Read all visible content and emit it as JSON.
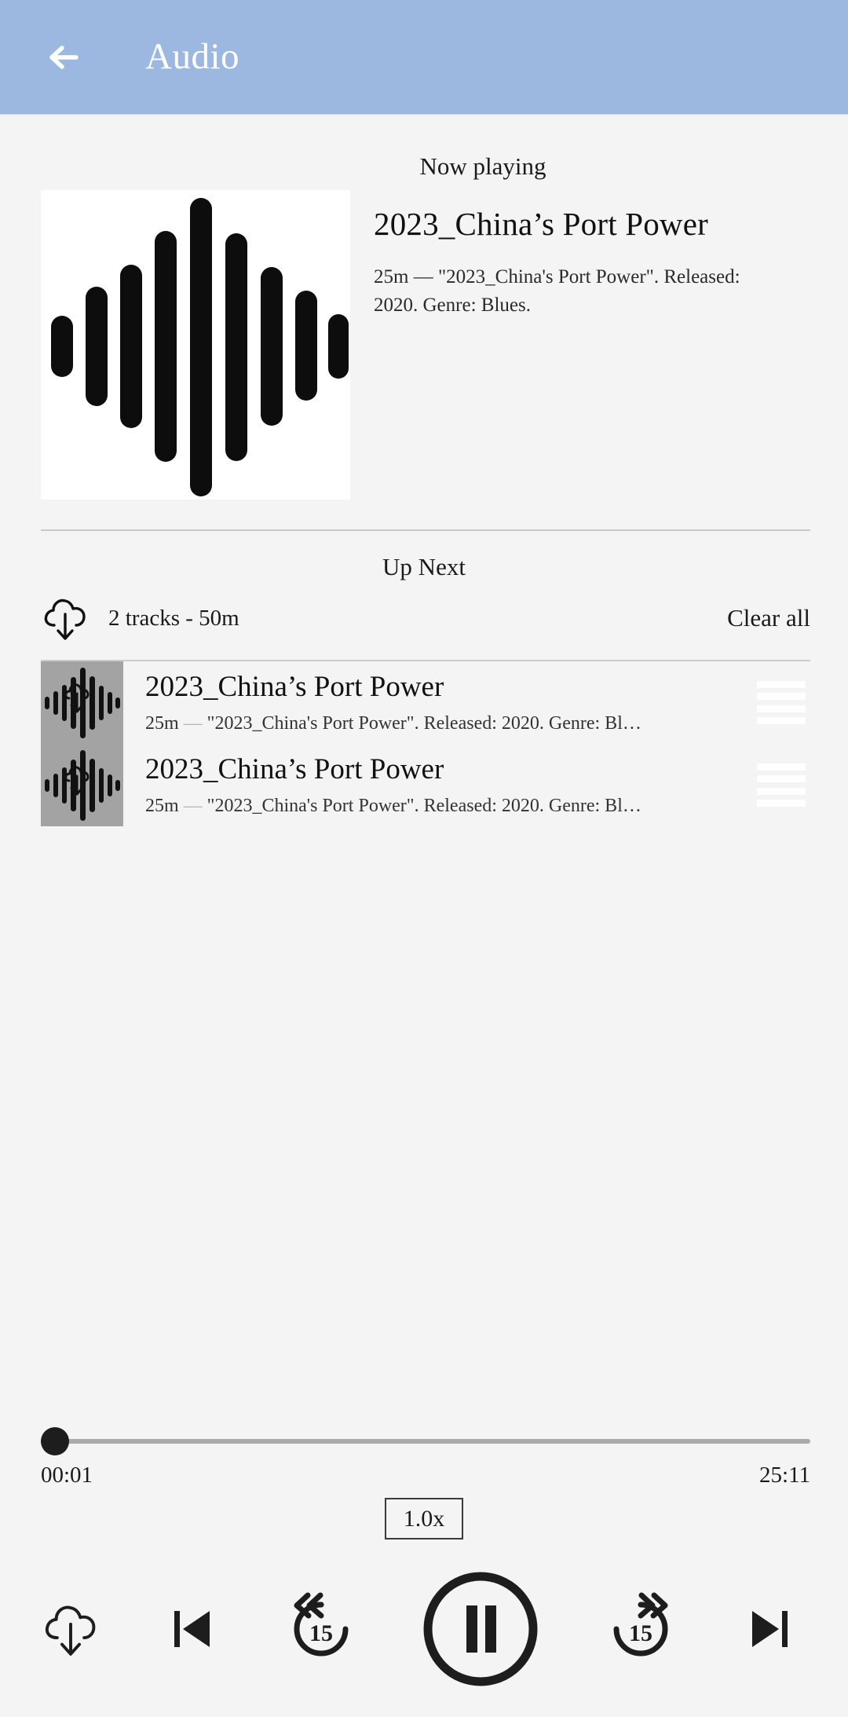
{
  "header": {
    "back_icon": "arrow-left-icon",
    "title": "Audio",
    "background_color": "#9cb8e0",
    "title_color": "#ffffff"
  },
  "now_playing": {
    "section_label": "Now playing",
    "album_art_icon": "audio-waveform-icon",
    "title": "2023_China’s Port Power",
    "description": "25m — \"2023_China's Port Power\". Released: 2020. Genre: Blues."
  },
  "up_next": {
    "section_label": "Up Next",
    "download_icon": "cloud-download-icon",
    "summary": "2 tracks - 50m",
    "clear_all_label": "Clear all",
    "tracks": [
      {
        "thumb_icon": "audio-waveform-download-icon",
        "title": "2023_China’s Port Power",
        "duration": "25m",
        "separator": "—",
        "subtitle": "\"2023_China's Port Power\". Released: 2020. Genre: Bl…",
        "drag_icon": "drag-handle-icon"
      },
      {
        "thumb_icon": "audio-waveform-download-icon",
        "title": "2023_China’s Port Power",
        "duration": "25m",
        "separator": "—",
        "subtitle": "\"2023_China's Port Power\". Released: 2020. Genre: Bl…",
        "drag_icon": "drag-handle-icon"
      }
    ]
  },
  "player": {
    "elapsed_time": "00:01",
    "total_time": "25:11",
    "progress_percent": 0,
    "speed_label": "1.0x",
    "controls": [
      {
        "name": "download-button",
        "icon": "cloud-download-icon"
      },
      {
        "name": "previous-track-button",
        "icon": "skip-previous-icon"
      },
      {
        "name": "rewind-15-button",
        "icon": "replay-15-icon",
        "label": "15"
      },
      {
        "name": "pause-button",
        "icon": "pause-circle-icon"
      },
      {
        "name": "forward-15-button",
        "icon": "forward-15-icon",
        "label": "15"
      },
      {
        "name": "next-track-button",
        "icon": "skip-next-icon"
      }
    ]
  },
  "colors": {
    "page_background": "#f4f4f4",
    "accent": "#9cb8e0",
    "text_primary": "#111111",
    "divider": "#c9c9c9",
    "thumb_background": "#a3a3a3"
  }
}
